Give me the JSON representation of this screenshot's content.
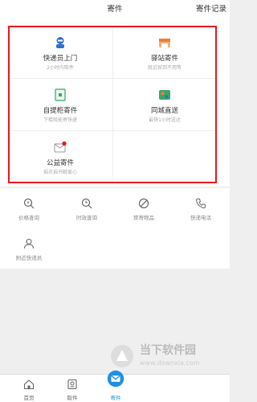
{
  "header": {
    "title": "寄件",
    "records_label": "寄件记录"
  },
  "services": [
    {
      "title": "快递员上门",
      "subtitle": "2小时内取件",
      "icon": "courier-icon",
      "color": "#2f6fd0"
    },
    {
      "title": "驿站寄件",
      "subtitle": "就近就到不用等",
      "icon": "station-icon",
      "color": "#f07d3b"
    },
    {
      "title": "自提柜寄件",
      "subtitle": "下楼就能寄快递",
      "icon": "locker-icon",
      "color": "#3aa766"
    },
    {
      "title": "同城直送",
      "subtitle": "最快1小时送达",
      "icon": "city-delivery-icon",
      "color": "#3aa766"
    },
    {
      "title": "公益寄件",
      "subtitle": "捐衣捐书献爱心",
      "icon": "charity-icon",
      "color": "#e8171f"
    }
  ],
  "tools": [
    {
      "label": "价格查询",
      "icon": "price-search-icon"
    },
    {
      "label": "时效查询",
      "icon": "time-search-icon"
    },
    {
      "label": "禁寄物品",
      "icon": "prohibited-icon"
    },
    {
      "label": "快递电话",
      "icon": "phone-icon"
    },
    {
      "label": "附近快递员",
      "icon": "nearby-courier-icon"
    }
  ],
  "tabs": [
    {
      "label": "首页",
      "icon": "home-icon"
    },
    {
      "label": "取件",
      "icon": "pickup-icon"
    },
    {
      "label": "寄件",
      "icon": "send-icon",
      "active": true
    }
  ],
  "watermark": {
    "main": "当下软件园",
    "url": "www.downxia.com"
  }
}
